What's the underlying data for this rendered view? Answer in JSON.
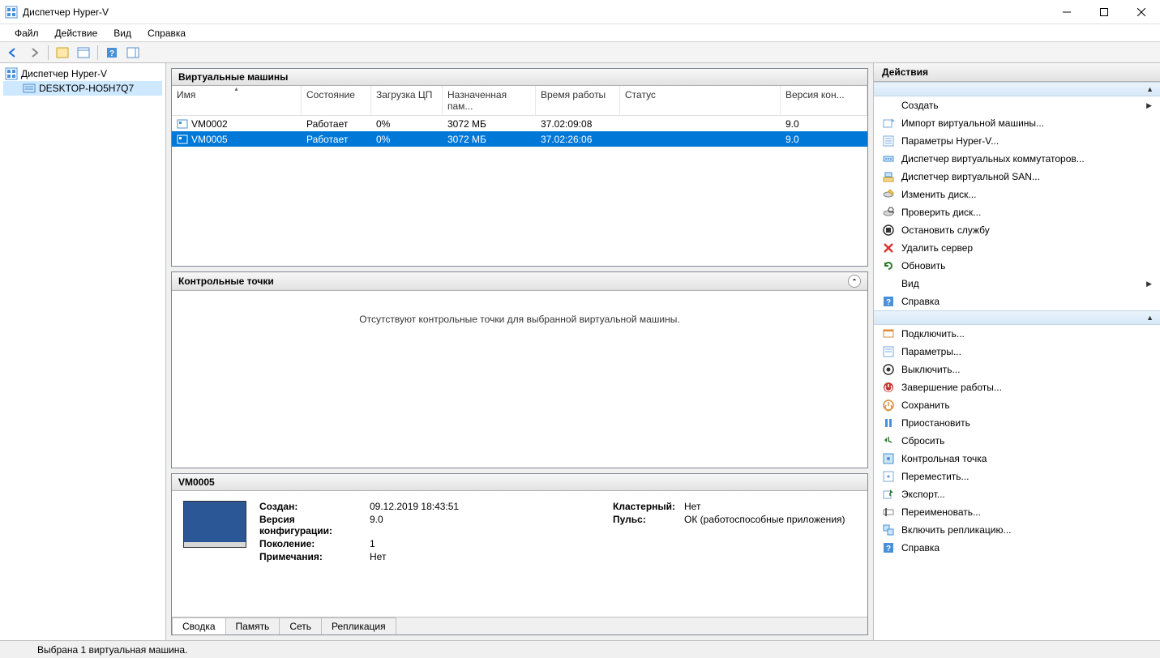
{
  "window": {
    "title": "Диспетчер Hyper-V"
  },
  "menu": {
    "file": "Файл",
    "action": "Действие",
    "view": "Вид",
    "help": "Справка"
  },
  "tree": {
    "root": "Диспетчер Hyper-V",
    "host": "DESKTOP-HO5H7Q7"
  },
  "vms": {
    "title": "Виртуальные машины",
    "columns": {
      "name": "Имя",
      "state": "Состояние",
      "cpu": "Загрузка ЦП",
      "memory": "Назначенная пам...",
      "uptime": "Время работы",
      "status": "Статус",
      "version": "Версия кон..."
    },
    "rows": [
      {
        "name": "VM0002",
        "state": "Работает",
        "cpu": "0%",
        "memory": "3072 МБ",
        "uptime": "37.02:09:08",
        "status": "",
        "version": "9.0",
        "selected": false
      },
      {
        "name": "VM0005",
        "state": "Работает",
        "cpu": "0%",
        "memory": "3072 МБ",
        "uptime": "37.02:26:06",
        "status": "",
        "version": "9.0",
        "selected": true
      }
    ]
  },
  "checkpoints": {
    "title": "Контрольные точки",
    "empty_msg": "Отсутствуют контрольные точки для выбранной виртуальной машины."
  },
  "details": {
    "title": "VM0005",
    "created_lbl": "Создан:",
    "created_val": "09.12.2019 18:43:51",
    "configver_lbl": "Версия конфигурации:",
    "configver_val": "9.0",
    "generation_lbl": "Поколение:",
    "generation_val": "1",
    "notes_lbl": "Примечания:",
    "notes_val": "Нет",
    "clustered_lbl": "Кластерный:",
    "clustered_val": "Нет",
    "heartbeat_lbl": "Пульс:",
    "heartbeat_val": "ОК (работоспособные приложения)",
    "tabs": {
      "summary": "Сводка",
      "memory": "Память",
      "network": "Сеть",
      "replication": "Репликация"
    }
  },
  "actions": {
    "title": "Действия",
    "host_items": [
      {
        "label": "Создать",
        "icon": "blank",
        "arrow": true
      },
      {
        "label": "Импорт виртуальной машины...",
        "icon": "import"
      },
      {
        "label": "Параметры Hyper-V...",
        "icon": "settings"
      },
      {
        "label": "Диспетчер виртуальных коммутаторов...",
        "icon": "switch"
      },
      {
        "label": "Диспетчер виртуальной SAN...",
        "icon": "san"
      },
      {
        "label": "Изменить диск...",
        "icon": "disk-edit"
      },
      {
        "label": "Проверить диск...",
        "icon": "disk-inspect"
      },
      {
        "label": "Остановить службу",
        "icon": "stop"
      },
      {
        "label": "Удалить сервер",
        "icon": "delete"
      },
      {
        "label": "Обновить",
        "icon": "refresh"
      },
      {
        "label": "Вид",
        "icon": "blank",
        "arrow": true
      },
      {
        "label": "Справка",
        "icon": "help"
      }
    ],
    "vm_items": [
      {
        "label": "Подключить...",
        "icon": "connect"
      },
      {
        "label": "Параметры...",
        "icon": "settings2"
      },
      {
        "label": "Выключить...",
        "icon": "turnoff"
      },
      {
        "label": "Завершение работы...",
        "icon": "shutdown"
      },
      {
        "label": "Сохранить",
        "icon": "save"
      },
      {
        "label": "Приостановить",
        "icon": "pause"
      },
      {
        "label": "Сбросить",
        "icon": "reset"
      },
      {
        "label": "Контрольная точка",
        "icon": "checkpoint"
      },
      {
        "label": "Переместить...",
        "icon": "move"
      },
      {
        "label": "Экспорт...",
        "icon": "export"
      },
      {
        "label": "Переименовать...",
        "icon": "rename"
      },
      {
        "label": "Включить репликацию...",
        "icon": "replication"
      },
      {
        "label": "Справка",
        "icon": "help"
      }
    ]
  },
  "statusbar": "Выбрана 1 виртуальная машина."
}
